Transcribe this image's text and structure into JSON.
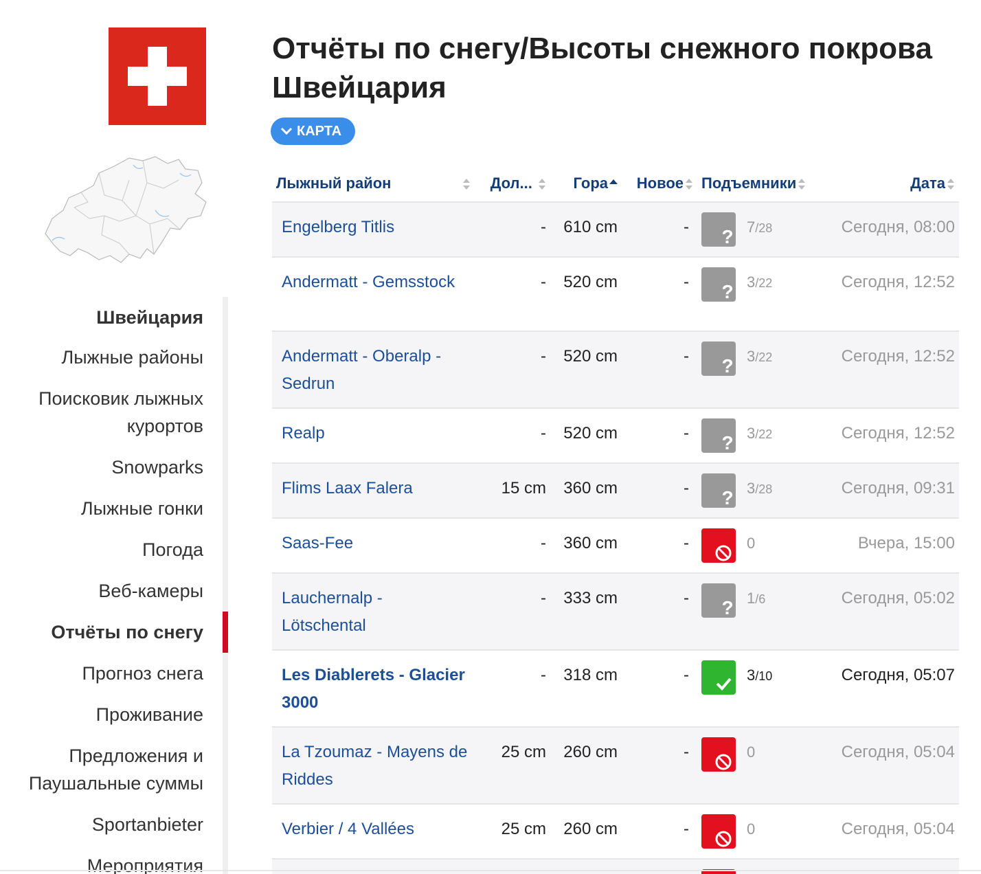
{
  "page": {
    "title_bold": "Отчёты по снегу/Высоты снежного покрова",
    "title_country": "Швейцария",
    "map_button": "КАРТА"
  },
  "nav": {
    "country": "Швейцария",
    "items": [
      "Лыжные районы",
      "Поисковик лыжных курортов",
      "Snowparks",
      "Лыжные гонки",
      "Погода",
      "Веб-камеры",
      "Отчёты по снегу",
      "Прогноз снега",
      "Проживание",
      "Предложения и Паушальные суммы",
      "Sportanbieter",
      "Мероприятия"
    ],
    "active_index": 6
  },
  "table": {
    "headers": {
      "area": "Лыжный район",
      "valley": "Дол...",
      "mountain": "Гора",
      "new": "Новое",
      "lifts": "Подъемники",
      "date": "Дата"
    },
    "rows": [
      {
        "area": "Engelberg Titlis",
        "valley": "-",
        "mountain": "610 cm",
        "new": "-",
        "status": "unknown",
        "lifts_open": "7",
        "lifts_total": "/28",
        "date": "Сегодня, 08:00"
      },
      {
        "area": "Andermatt - Gemsstock",
        "valley": "-",
        "mountain": "520 cm",
        "new": "-",
        "status": "unknown",
        "lifts_open": "3",
        "lifts_total": "/22",
        "date": "Сегодня, 12:52"
      },
      {
        "area": "Andermatt - Oberalp - Sedrun",
        "valley": "-",
        "mountain": "520 cm",
        "new": "-",
        "status": "unknown",
        "lifts_open": "3",
        "lifts_total": "/22",
        "date": "Сегодня, 12:52"
      },
      {
        "area": "Realp",
        "valley": "-",
        "mountain": "520 cm",
        "new": "-",
        "status": "unknown",
        "lifts_open": "3",
        "lifts_total": "/22",
        "date": "Сегодня, 12:52"
      },
      {
        "area": "Flims Laax Falera",
        "valley": "15 cm",
        "mountain": "360 cm",
        "new": "-",
        "status": "unknown",
        "lifts_open": "3",
        "lifts_total": "/28",
        "date": "Сегодня, 09:31"
      },
      {
        "area": "Saas-Fee",
        "valley": "-",
        "mountain": "360 cm",
        "new": "-",
        "status": "closed",
        "lifts_open": "0",
        "lifts_total": "",
        "date": "Вчера, 15:00"
      },
      {
        "area": "Lauchernalp - Lötschental",
        "valley": "-",
        "mountain": "333 cm",
        "new": "-",
        "status": "unknown",
        "lifts_open": "1",
        "lifts_total": "/6",
        "date": "Сегодня, 05:02"
      },
      {
        "area": "Les Diablerets - Glacier 3000",
        "valley": "-",
        "mountain": "318 cm",
        "new": "-",
        "status": "open",
        "lifts_open": "3",
        "lifts_total": "/10",
        "date": "Сегодня, 05:07",
        "highlight": true
      },
      {
        "area": "La Tzoumaz - Mayens de Riddes",
        "valley": "25 cm",
        "mountain": "260 cm",
        "new": "-",
        "status": "closed",
        "lifts_open": "0",
        "lifts_total": "",
        "date": "Сегодня, 05:04"
      },
      {
        "area": "Verbier / 4 Vallées",
        "valley": "25 cm",
        "mountain": "260 cm",
        "new": "-",
        "status": "closed",
        "lifts_open": "0",
        "lifts_total": "",
        "date": "Сегодня, 05:04"
      },
      {
        "area": "",
        "valley": "",
        "mountain": "",
        "new": "",
        "status": "closed",
        "lifts_open": "",
        "lifts_total": "",
        "date": ""
      }
    ]
  }
}
